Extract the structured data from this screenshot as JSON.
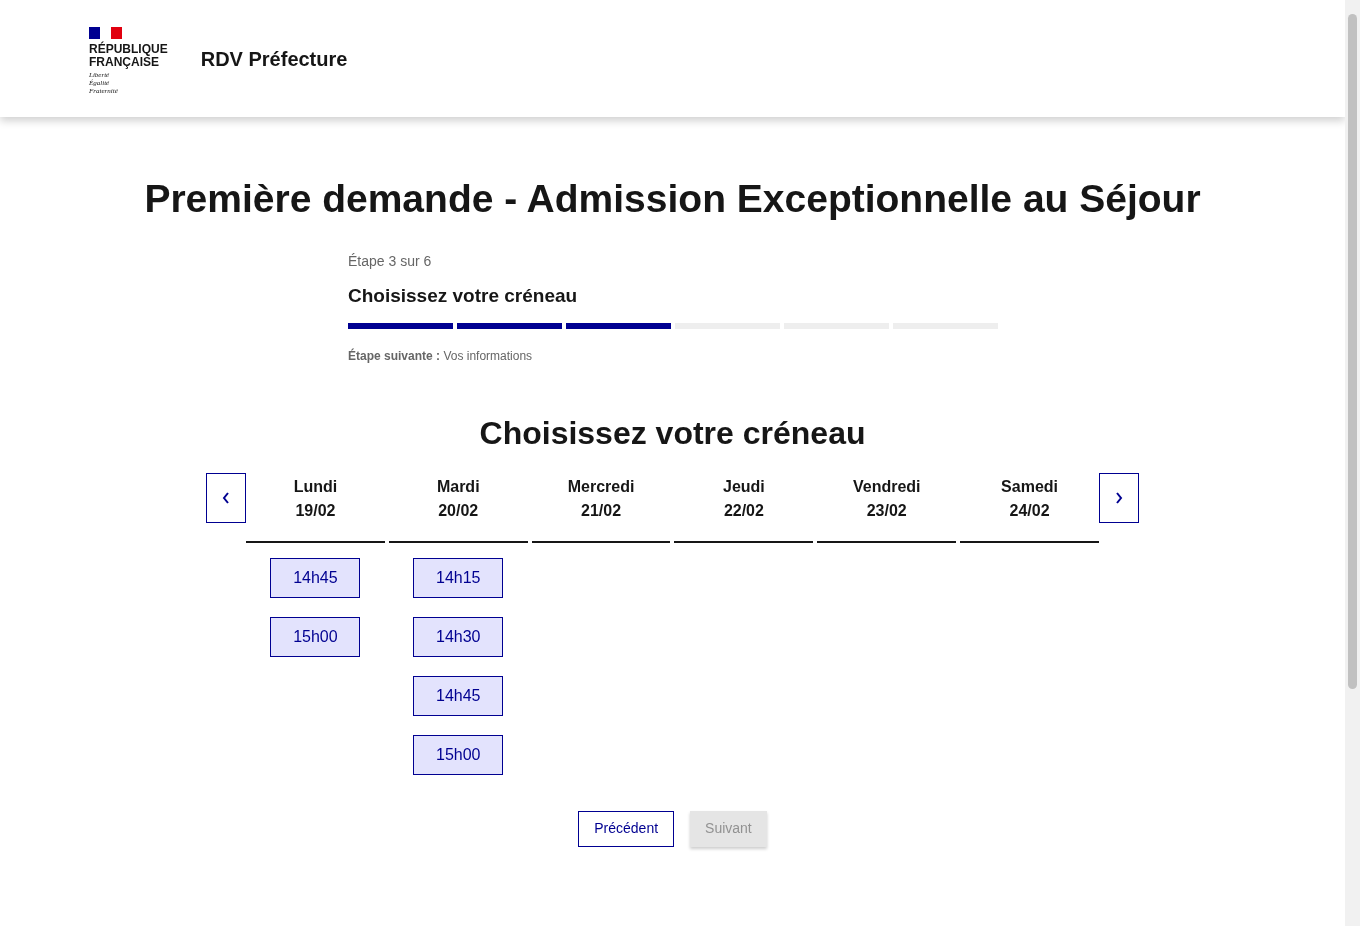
{
  "header": {
    "logo_lines": [
      "RÉPUBLIQUE",
      "FRANÇAISE"
    ],
    "motto": [
      "Liberté",
      "Égalité",
      "Fraternité"
    ],
    "service_name": "RDV Préfecture"
  },
  "title": "Première demande - Admission Exceptionnelle au Séjour",
  "stepper": {
    "counter": "Étape 3 sur 6",
    "current": "Choisissez votre créneau",
    "segments": [
      {
        "done": true
      },
      {
        "done": true
      },
      {
        "done": true
      },
      {
        "done": false
      },
      {
        "done": false
      },
      {
        "done": false
      }
    ],
    "next_label": "Étape suivante :",
    "next_value": "Vos informations"
  },
  "slots_heading": "Choisissez votre créneau",
  "days": [
    {
      "name": "Lundi",
      "date": "19/02",
      "slots": [
        "14h45",
        "15h00"
      ]
    },
    {
      "name": "Mardi",
      "date": "20/02",
      "slots": [
        "14h15",
        "14h30",
        "14h45",
        "15h00"
      ]
    },
    {
      "name": "Mercredi",
      "date": "21/02"
    },
    {
      "name": "Jeudi",
      "date": "22/02"
    },
    {
      "name": "Vendredi",
      "date": "23/02"
    },
    {
      "name": "Samedi",
      "date": "24/02"
    }
  ],
  "buttons": [
    {
      "label": "Précédent",
      "disabled": false
    },
    {
      "label": "Suivant",
      "disabled": true
    }
  ]
}
